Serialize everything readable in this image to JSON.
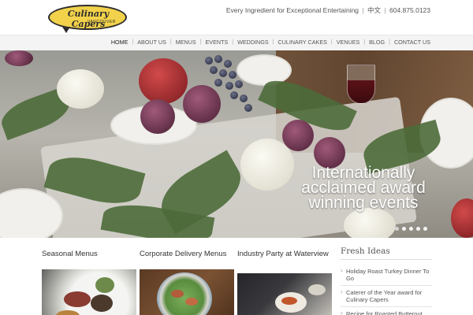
{
  "header": {
    "logo_text": "Culinary Capers",
    "logo_sub": "VANCOUVER",
    "tagline": "Every Ingredient for Exceptional Entertaining",
    "lang_glyph": "中文",
    "phone": "604.875.0123"
  },
  "nav": {
    "items": [
      "HOME",
      "ABOUT US",
      "MENUS",
      "EVENTS",
      "WEDDINGS",
      "CULINARY CAKES",
      "VENUES",
      "BLOG",
      "CONTACT US"
    ],
    "active_index": 0
  },
  "hero": {
    "caption_line1": "Internationally",
    "caption_line2": "acclaimed award",
    "caption_line3": "winning events",
    "slide_count": 5,
    "active_slide": 1
  },
  "cards": [
    {
      "title": "Seasonal Menus"
    },
    {
      "title": "Corporate Delivery Menus"
    },
    {
      "title": "Industry Party at Waterview"
    }
  ],
  "sidebar": {
    "title": "Fresh Ideas",
    "items": [
      "Holiday Roast Turkey Dinner To Go",
      "Caterer of the Year award for Culinary Capers",
      "Recipe for Roasted Butternut"
    ]
  },
  "colors": {
    "logo_yellow": "#f2d24a",
    "nav_bg": "#f4f4f4"
  },
  "icons": [
    "logo-badge",
    "language-toggle",
    "slide-dot"
  ]
}
